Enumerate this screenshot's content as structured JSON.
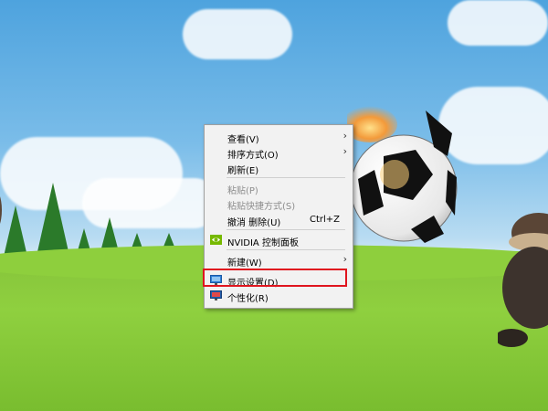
{
  "context_menu": {
    "items": [
      {
        "label": "查看(V)",
        "submenu": true,
        "enabled": true
      },
      {
        "label": "排序方式(O)",
        "submenu": true,
        "enabled": true
      },
      {
        "label": "刷新(E)",
        "enabled": true
      },
      {
        "label": "粘贴(P)",
        "enabled": false
      },
      {
        "label": "粘贴快捷方式(S)",
        "enabled": false
      },
      {
        "label": "撤消 删除(U)",
        "shortcut": "Ctrl+Z",
        "enabled": true
      },
      {
        "label": "NVIDIA 控制面板",
        "icon": "nvidia-icon",
        "enabled": true
      },
      {
        "label": "新建(W)",
        "submenu": true,
        "enabled": true
      },
      {
        "label": "显示设置(D)",
        "icon": "display-settings-icon",
        "enabled": true,
        "highlighted": true
      },
      {
        "label": "个性化(R)",
        "icon": "personalize-icon",
        "enabled": true
      }
    ]
  },
  "colors": {
    "highlight_border": "#e0151f",
    "menu_background": "#f2f2f2",
    "disabled_text": "#8d8d8d"
  }
}
